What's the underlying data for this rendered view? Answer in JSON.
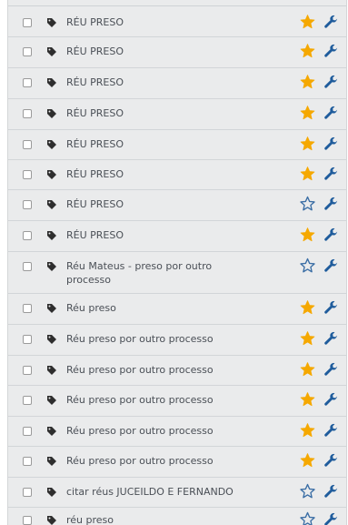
{
  "colors": {
    "panel_bg": "#eaebec",
    "text": "#4a4f56",
    "star_filled": "#f5a800",
    "star_outline": "#3b6ea5",
    "wrench": "#1f5c9c",
    "tag_icon": "#2e2e2e"
  },
  "icons": {
    "checkbox": "checkbox",
    "tag": "tag-icon",
    "favorite": "star-icon",
    "settings": "wrench-icon"
  },
  "rows": [
    {
      "label": "RÉU PRESO",
      "starred": true
    },
    {
      "label": "RÉU PRESO",
      "starred": true
    },
    {
      "label": "RÉU PRESO",
      "starred": true
    },
    {
      "label": "RÉU PRESO",
      "starred": true
    },
    {
      "label": "RÉU PRESO",
      "starred": true
    },
    {
      "label": "RÉU PRESO",
      "starred": true
    },
    {
      "label": "RÉU PRESO",
      "starred": false
    },
    {
      "label": "RÉU PRESO",
      "starred": true
    },
    {
      "label": "Réu Mateus - preso por outro processo",
      "starred": false
    },
    {
      "label": "Réu preso",
      "starred": true
    },
    {
      "label": "Réu preso por outro processo",
      "starred": true
    },
    {
      "label": "Réu preso por outro processo",
      "starred": true
    },
    {
      "label": "Réu preso por outro processo",
      "starred": true
    },
    {
      "label": "Réu preso por outro processo",
      "starred": true
    },
    {
      "label": "Réu preso por outro processo",
      "starred": true
    },
    {
      "label": "citar réus JUCEILDO E FERNANDO",
      "starred": false
    },
    {
      "label": "réu preso",
      "starred": false
    }
  ]
}
